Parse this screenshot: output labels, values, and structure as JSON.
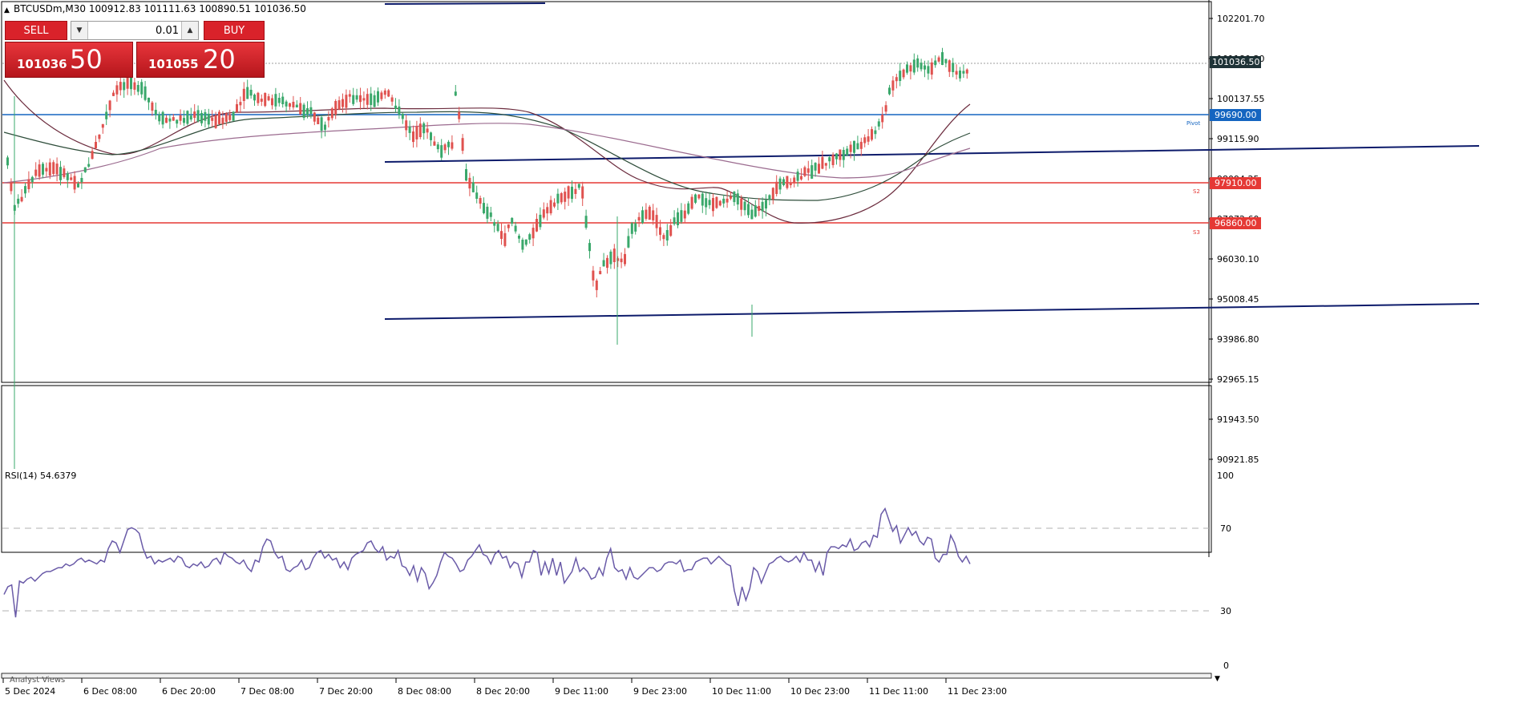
{
  "header": {
    "symbol_line": "BTCUSDm,M30  100912.83 101111.63 100890.51 101036.50"
  },
  "one_click": {
    "sell_label": "SELL",
    "buy_label": "BUY",
    "lot_value": "0.01",
    "sell_big": "101036",
    "sell_pips": "50",
    "buy_big": "101055",
    "buy_pips": "20"
  },
  "price_axis": {
    "ticks": [
      "102201.70",
      "101180.30",
      "100137.55",
      "99115.90",
      "98094.25",
      "97072.60",
      "96030.10",
      "95008.45",
      "93986.80",
      "92965.15",
      "91943.50",
      "90921.85"
    ],
    "current_price": "101036.50",
    "levels": [
      {
        "label": "99690.00",
        "color": "#1565c0",
        "tag": "Pivot"
      },
      {
        "label": "97910.00",
        "color": "#e53935",
        "tag": "S2"
      },
      {
        "label": "96860.00",
        "color": "#e53935",
        "tag": "S3"
      }
    ]
  },
  "time_axis": {
    "ticks": [
      "5 Dec 2024",
      "6 Dec 08:00",
      "6 Dec 20:00",
      "7 Dec 08:00",
      "7 Dec 20:00",
      "8 Dec 08:00",
      "8 Dec 20:00",
      "9 Dec 11:00",
      "9 Dec 23:00",
      "10 Dec 11:00",
      "10 Dec 23:00",
      "11 Dec 11:00",
      "11 Dec 23:00"
    ]
  },
  "rsi": {
    "label": "RSI(14) 54.6379",
    "ticks": [
      "100",
      "70",
      "30",
      "0"
    ],
    "values": [
      38,
      42,
      43,
      26,
      45,
      44,
      46,
      47,
      45,
      47,
      49,
      50,
      50,
      51,
      52,
      52,
      54,
      53,
      54,
      56,
      57,
      55,
      56,
      55,
      54,
      56,
      55,
      62,
      66,
      65,
      60,
      66,
      72,
      73,
      72,
      70,
      62,
      57,
      58,
      54,
      56,
      55,
      56,
      57,
      55,
      58,
      57,
      53,
      52,
      54,
      53,
      55,
      52,
      53,
      56,
      57,
      54,
      60,
      58,
      57,
      55,
      54,
      56,
      52,
      50,
      56,
      55,
      63,
      67,
      66,
      60,
      57,
      58,
      51,
      50,
      52,
      53,
      56,
      51,
      52,
      57,
      60,
      61,
      57,
      59,
      56,
      57,
      52,
      55,
      51,
      57,
      59,
      60,
      61,
      65,
      66,
      62,
      60,
      63,
      56,
      58,
      57,
      61,
      53,
      52,
      48,
      53,
      45,
      52,
      49,
      41,
      44,
      48,
      55,
      60,
      58,
      57,
      54,
      50,
      51,
      56,
      58,
      61,
      64,
      59,
      58,
      54,
      59,
      61,
      57,
      58,
      52,
      55,
      54,
      47,
      55,
      55,
      61,
      60,
      48,
      55,
      49,
      57,
      48,
      55,
      44,
      47,
      50,
      57,
      50,
      52,
      50,
      46,
      47,
      52,
      48,
      57,
      62,
      52,
      50,
      51,
      46,
      52,
      47,
      46,
      48,
      50,
      52,
      52,
      50,
      51,
      54,
      55,
      55,
      54,
      56,
      50,
      51,
      51,
      55,
      56,
      57,
      57,
      54,
      56,
      58,
      56,
      54,
      53,
      40,
      32,
      42,
      35,
      41,
      52,
      50,
      44,
      49,
      54,
      55,
      57,
      58,
      56,
      55,
      56,
      58,
      55,
      60,
      56,
      56,
      50,
      55,
      48,
      60,
      63,
      63,
      62,
      64,
      63,
      67,
      61,
      62,
      65,
      66,
      63,
      69,
      68,
      80,
      83,
      77,
      71,
      74,
      65,
      69,
      73,
      69,
      71,
      66,
      64,
      68,
      67,
      57,
      55,
      59,
      59,
      69,
      65,
      58,
      55,
      58,
      54
    ]
  },
  "bottom_tab": {
    "label": "Analyst Views"
  }
}
